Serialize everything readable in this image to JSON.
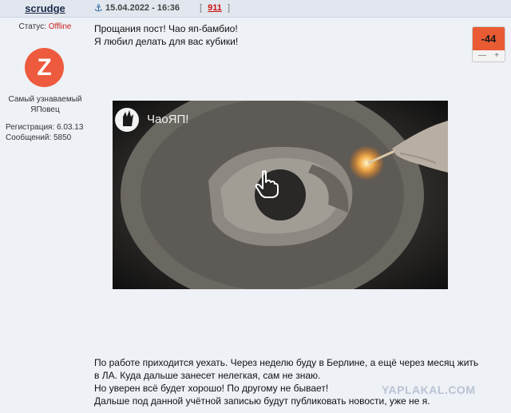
{
  "user": {
    "name": "scrudge",
    "status_label": "Статус:",
    "status_value": "Offline",
    "avatar_letter": "Z",
    "rank_line1": "Самый узнаваемый",
    "rank_line2": "ЯПовец",
    "registration": "Регистрация: 6.03.13",
    "messages": "Сообщений: 5850"
  },
  "post": {
    "anchor_icon": "anchor-icon",
    "date": "15.04.2022 - 16:36",
    "number_open": "[",
    "number": "911",
    "number_close": "]",
    "line1": "Прощания пост! Чао яп-бамбио!",
    "line2": "Я любил делать для вас кубики!",
    "rating": "-44",
    "rating_minus": "—",
    "rating_plus": "+",
    "body_line1": "По работе приходится уехать. Через неделю буду в Берлине, а ещё через месяц жить",
    "body_line2": "в ЛА. Куда дальше занесет нелегкая, сам не знаю.",
    "body_line3": "Но уверен всё будет хорошо! По другому не бывает!",
    "body_line4": "Дальше под данной учётной записью будут публиковать новости, уже не я."
  },
  "video": {
    "logo_text": "ЧаоЯП!",
    "play_icon": "hand-pointer-icon"
  },
  "watermark": "YAPLAKAL.COM",
  "colors": {
    "accent": "#e95b33",
    "header_bg": "#e2e7ef",
    "panel_bg": "#eef1f6",
    "offline": "#cc2222",
    "avatar": "#ee5a3d"
  }
}
